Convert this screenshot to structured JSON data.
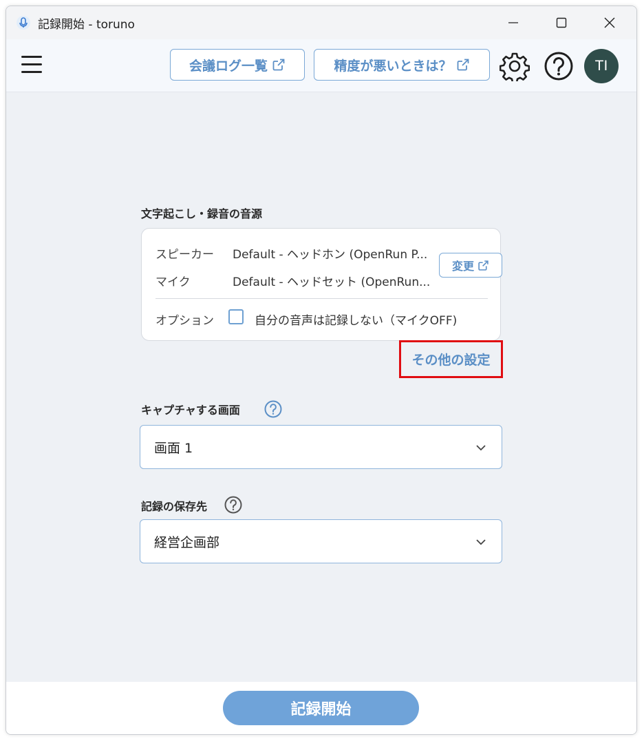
{
  "window": {
    "title": "記録開始 - toruno"
  },
  "toolbar": {
    "meeting_log_label": "会議ログ一覧",
    "accuracy_help_label": "精度が悪いときは？",
    "avatar_initials": "TI"
  },
  "audio_source": {
    "section_title": "文字起こし・録音の音源",
    "speaker_label": "スピーカー",
    "speaker_value": "Default - ヘッドホン (OpenRun P...",
    "mic_label": "マイク",
    "mic_value": "Default - ヘッドセット (OpenRun...",
    "change_label": "変更",
    "option_label": "オプション",
    "option_checkbox_label": "自分の音声は記録しない（マイクOFF)",
    "option_checked": false,
    "other_settings_label": "その他の設定"
  },
  "capture_screen": {
    "section_title": "キャプチャする画面",
    "selected": "画面 1"
  },
  "save_destination": {
    "section_title": "記録の保存先",
    "selected": "経営企画部"
  },
  "footer": {
    "start_label": "記録開始"
  },
  "colors": {
    "accent": "#5b8fc6",
    "start_button": "#6fa3d9",
    "highlight_box": "#e00d12",
    "avatar_bg": "#2f4d4a"
  }
}
